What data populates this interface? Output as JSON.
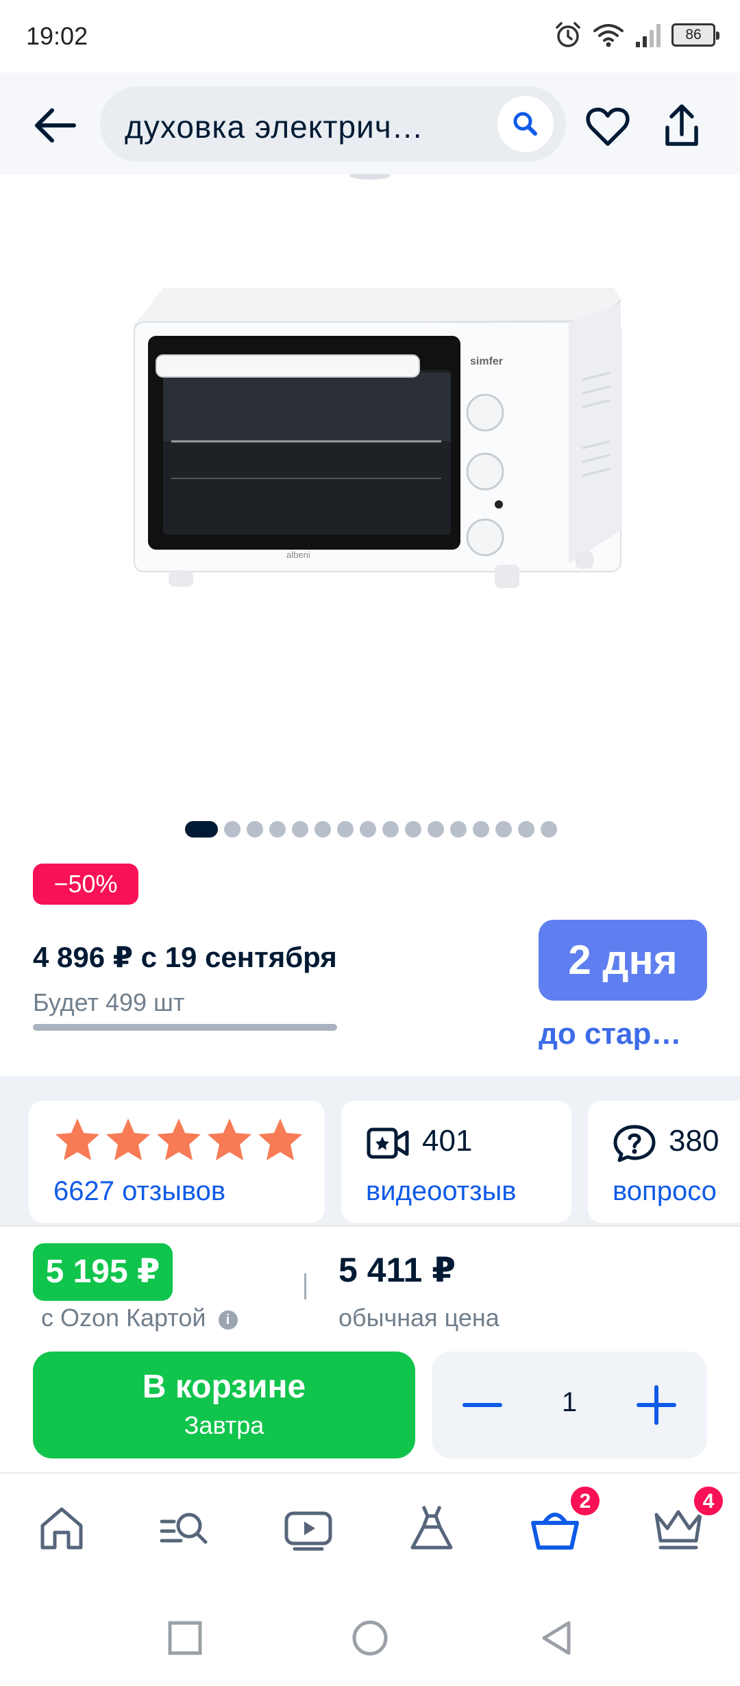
{
  "status_bar": {
    "time": "19:02",
    "battery": "86"
  },
  "header": {
    "search_query": "духовка электрич…"
  },
  "gallery": {
    "total_images": 16,
    "active_index": 0
  },
  "promo": {
    "discount": "−50%",
    "future_price": "4 896 ₽ с 19 сентября",
    "will_be": "Будет 499 шт",
    "stock_progress": 1.0,
    "days_badge": "2 дня",
    "days_sub": "до стар…"
  },
  "cards": {
    "reviews": {
      "rating_stars": 5,
      "label": "6627 отзывов"
    },
    "videos": {
      "count": "401",
      "label": "видеоотзыв"
    },
    "questions": {
      "count": "380",
      "label": "вопросо"
    }
  },
  "buy": {
    "ozon_price": "5 195 ₽",
    "ozon_label": "с Ozon Картой",
    "regular_price": "5 411 ₽",
    "regular_label": "обычная цена",
    "cart_label": "В корзине",
    "cart_sub": "Завтра",
    "quantity": "1"
  },
  "bottom_nav": {
    "items": [
      "home-icon",
      "catalog-search-icon",
      "video-icon",
      "fashion-icon",
      "cart-icon",
      "premium-icon"
    ],
    "cart_badge": "2",
    "premium_badge": "4"
  },
  "colors": {
    "accent_blue": "#0f5be8",
    "green": "#10c44c",
    "discount_red": "#f91155",
    "days_badge": "#5f7ff0",
    "star": "#f77b55"
  }
}
